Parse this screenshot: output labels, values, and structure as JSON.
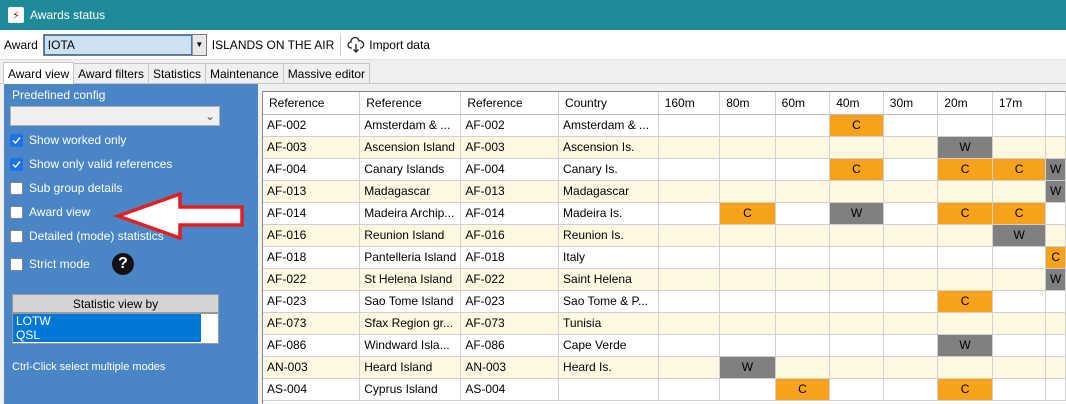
{
  "window": {
    "title": "Awards status"
  },
  "toolbar": {
    "award_label": "Award",
    "award_value": "IOTA",
    "award_name": "ISLANDS ON THE AIR",
    "import_label": "Import data"
  },
  "tabs": [
    {
      "label": "Award view",
      "active": true
    },
    {
      "label": "Award filters",
      "active": false
    },
    {
      "label": "Statistics",
      "active": false
    },
    {
      "label": "Maintenance",
      "active": false
    },
    {
      "label": "Massive editor",
      "active": false
    }
  ],
  "panel": {
    "predefined_label": "Predefined config",
    "predefined_value": "",
    "options": [
      {
        "label": "Show worked only",
        "checked": true
      },
      {
        "label": "Show only valid references",
        "checked": true
      },
      {
        "label": "Sub group details",
        "checked": false
      },
      {
        "label": "Award view",
        "checked": false
      },
      {
        "label": "Detailed (mode) statistics",
        "checked": false
      },
      {
        "label": "Strict mode",
        "checked": false
      }
    ],
    "stat_header": "Statistic view by",
    "stat_items": [
      "LOTW",
      "QSL"
    ],
    "hint": "Ctrl-Click select multiple modes"
  },
  "grid": {
    "columns": [
      "Reference",
      "Reference",
      "Reference",
      "Country",
      "160m",
      "80m",
      "60m",
      "40m",
      "30m",
      "20m",
      "17m",
      ""
    ],
    "rows": [
      [
        "AF-002",
        "Amsterdam & ...",
        "AF-002",
        "Amsterdam & ...",
        "",
        "",
        "",
        "C",
        "",
        "",
        "",
        ""
      ],
      [
        "AF-003",
        "Ascension Island",
        "AF-003",
        "Ascension Is.",
        "",
        "",
        "",
        "",
        "",
        "W",
        "",
        ""
      ],
      [
        "AF-004",
        "Canary Islands",
        "AF-004",
        "Canary Is.",
        "",
        "",
        "",
        "C",
        "",
        "C",
        "C",
        "W"
      ],
      [
        "AF-013",
        "Madagascar",
        "AF-013",
        "Madagascar",
        "",
        "",
        "",
        "",
        "",
        "",
        "",
        "W"
      ],
      [
        "AF-014",
        "Madeira Archip...",
        "AF-014",
        "Madeira Is.",
        "",
        "C",
        "",
        "W",
        "",
        "C",
        "C",
        ""
      ],
      [
        "AF-016",
        "Reunion Island",
        "AF-016",
        "Reunion Is.",
        "",
        "",
        "",
        "",
        "",
        "",
        "W",
        ""
      ],
      [
        "AF-018",
        "Pantelleria Island",
        "AF-018",
        "Italy",
        "",
        "",
        "",
        "",
        "",
        "",
        "",
        "C"
      ],
      [
        "AF-022",
        "St Helena Island",
        "AF-022",
        "Saint Helena",
        "",
        "",
        "",
        "",
        "",
        "",
        "",
        "W"
      ],
      [
        "AF-023",
        "Sao Tome Island",
        "AF-023",
        "Sao Tome & P...",
        "",
        "",
        "",
        "",
        "",
        "C",
        "",
        ""
      ],
      [
        "AF-073",
        "Sfax Region gr...",
        "AF-073",
        "Tunisia",
        "",
        "",
        "",
        "",
        "",
        "",
        "",
        ""
      ],
      [
        "AF-086",
        "Windward Isla...",
        "AF-086",
        "Cape Verde",
        "",
        "",
        "",
        "",
        "",
        "W",
        "",
        ""
      ],
      [
        "AN-003",
        "Heard Island",
        "AN-003",
        "Heard Is.",
        "",
        "W",
        "",
        "",
        "",
        "",
        "",
        ""
      ],
      [
        "AS-004",
        "Cyprus Island",
        "AS-004",
        "",
        "",
        "",
        "C",
        "",
        "",
        "C",
        "",
        ""
      ]
    ]
  },
  "colors": {
    "titlebar": "#1f8a98",
    "panel": "#4a85c5",
    "confirmed": "#f7a21b",
    "worked": "#808080",
    "arrow": "#e02020"
  }
}
